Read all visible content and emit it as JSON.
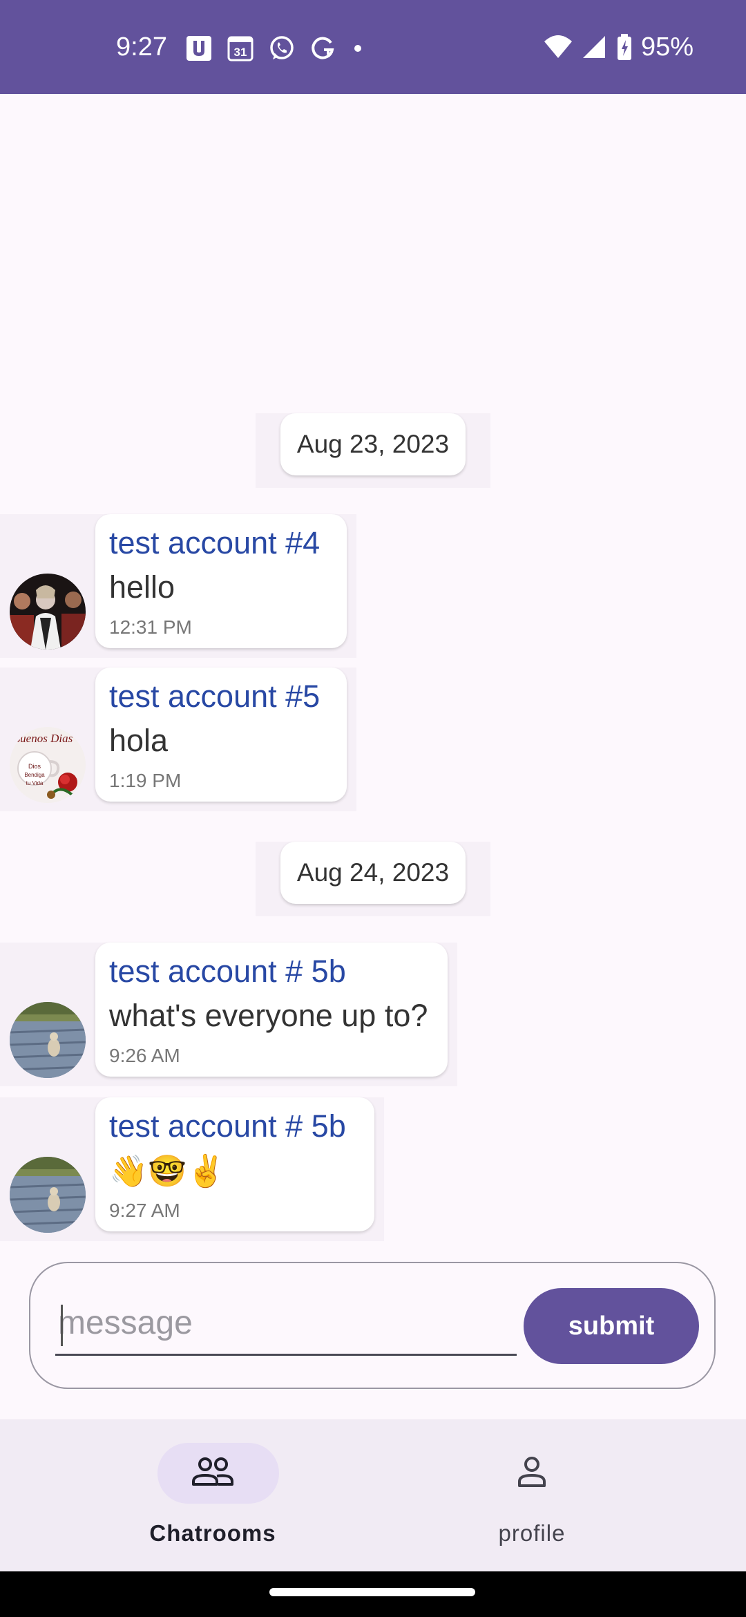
{
  "status_bar": {
    "time": "9:27",
    "battery": "95%",
    "calendar_day": "31",
    "left_icons": [
      "u-app-icon",
      "calendar-icon",
      "whatsapp-icon",
      "grammarly-icon",
      "dot-icon"
    ],
    "right_icons": [
      "wifi-icon",
      "cell-signal-icon",
      "battery-charging-icon"
    ],
    "color": "#62529c"
  },
  "chat": {
    "date_1": "Aug 23, 2023",
    "date_2": "Aug 24, 2023",
    "messages": [
      {
        "sender": "test account #4",
        "text": "hello",
        "time": "12:31 PM",
        "avatar": "avatar-photo-people"
      },
      {
        "sender": "test account #5",
        "text": "hola",
        "time": "1:19 PM",
        "avatar": "avatar-buenos-dias-card"
      },
      {
        "sender": "test account # 5b",
        "text": "what's everyone up to?",
        "time": "9:26 AM",
        "avatar": "avatar-dog-on-deck"
      },
      {
        "sender": "test account # 5b",
        "text": "👋🤓✌️",
        "time": "9:27 AM",
        "avatar": "avatar-dog-on-deck"
      }
    ],
    "avatar_text_buenos": "Buenos Dias",
    "avatar_text_small": "Dios Bendiga tu Vida"
  },
  "composer": {
    "placeholder": "message",
    "value": "",
    "submit_label": "submit"
  },
  "bottom_nav": {
    "items": [
      {
        "label": "Chatrooms",
        "icon": "people-icon",
        "active": true
      },
      {
        "label": "profile",
        "icon": "person-icon",
        "active": false
      }
    ]
  },
  "colors": {
    "accent": "#62529c",
    "sender_name": "#2848a4",
    "active_pill": "#e7def4"
  }
}
